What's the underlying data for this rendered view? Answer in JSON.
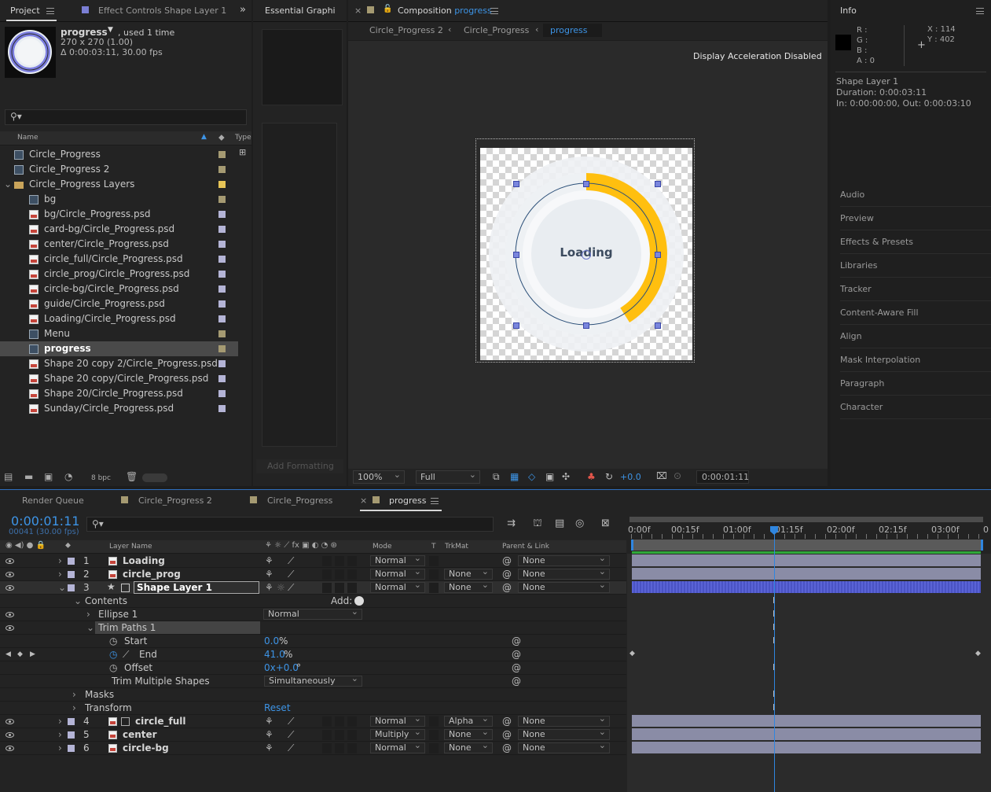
{
  "project_panel": {
    "tabs": [
      "Project",
      "Effect Controls Shape Layer 1"
    ],
    "preview_name": "progress",
    "preview_used": ", used 1 time",
    "preview_dims": "270 x 270 (1.00)",
    "preview_duration": "Δ 0:00:03:11, 30.00 fps",
    "col_name": "Name",
    "col_type": "Type",
    "bpc": "8 bpc",
    "items": [
      {
        "name": "Circle_Progress",
        "icon": "composition-icon",
        "indent": 0,
        "label": "#a59a72"
      },
      {
        "name": "Circle_Progress 2",
        "icon": "composition-icon",
        "indent": 0,
        "label": "#a59a72"
      },
      {
        "name": "Circle_Progress Layers",
        "icon": "folder-icon",
        "indent": 0,
        "label": "#e6c456",
        "expanded": true
      },
      {
        "name": "bg",
        "icon": "composition-icon",
        "indent": 1,
        "label": "#a59a72"
      },
      {
        "name": "bg/Circle_Progress.psd",
        "icon": "psd-icon",
        "indent": 1,
        "label": "#b4b4d6"
      },
      {
        "name": "card-bg/Circle_Progress.psd",
        "icon": "psd-icon",
        "indent": 1,
        "label": "#b4b4d6"
      },
      {
        "name": "center/Circle_Progress.psd",
        "icon": "psd-icon",
        "indent": 1,
        "label": "#b4b4d6"
      },
      {
        "name": "circle_full/Circle_Progress.psd",
        "icon": "psd-icon",
        "indent": 1,
        "label": "#b4b4d6"
      },
      {
        "name": "circle_prog/Circle_Progress.psd",
        "icon": "psd-icon",
        "indent": 1,
        "label": "#b4b4d6"
      },
      {
        "name": "circle-bg/Circle_Progress.psd",
        "icon": "psd-icon",
        "indent": 1,
        "label": "#b4b4d6"
      },
      {
        "name": "guide/Circle_Progress.psd",
        "icon": "psd-icon",
        "indent": 1,
        "label": "#b4b4d6"
      },
      {
        "name": "Loading/Circle_Progress.psd",
        "icon": "psd-icon",
        "indent": 1,
        "label": "#b4b4d6"
      },
      {
        "name": "Menu",
        "icon": "composition-icon",
        "indent": 1,
        "label": "#a59a72"
      },
      {
        "name": "progress",
        "icon": "composition-icon",
        "indent": 1,
        "label": "#a59a72",
        "selected": true
      },
      {
        "name": "Shape 20 copy 2/Circle_Progress.psd",
        "icon": "psd-icon",
        "indent": 1,
        "label": "#b4b4d6"
      },
      {
        "name": "Shape 20 copy/Circle_Progress.psd",
        "icon": "psd-icon",
        "indent": 1,
        "label": "#b4b4d6"
      },
      {
        "name": "Shape 20/Circle_Progress.psd",
        "icon": "psd-icon",
        "indent": 1,
        "label": "#b4b4d6"
      },
      {
        "name": "Sunday/Circle_Progress.psd",
        "icon": "psd-icon",
        "indent": 1,
        "label": "#b4b4d6"
      }
    ]
  },
  "essential_graphics": {
    "tab": "Essential Graphi",
    "add_formatting": "Add Formatting"
  },
  "composition": {
    "tab_prefix": "Composition",
    "tab_name": "progress",
    "breadcrumbs": [
      "Circle_Progress 2",
      "Circle_Progress",
      "progress"
    ],
    "notice": "Display Acceleration Disabled",
    "center_text": "Loading",
    "progress_fraction": 0.41,
    "accent_color": "#ffbf0f",
    "zoom": "100%",
    "resolution": "Full",
    "exposure": "+0.0",
    "timecode": "0:00:01:11"
  },
  "info_panel": {
    "tab": "Info",
    "r": "R :",
    "g": "G :",
    "b": "B :",
    "a": "A :  0",
    "x": "X : 114",
    "y": "Y : 402",
    "layer": "Shape Layer 1",
    "duration": "Duration: 0:00:03:11",
    "in_out": "In: 0:00:00:00, Out: 0:00:03:10"
  },
  "right_panels": [
    "Audio",
    "Preview",
    "Effects & Presets",
    "Libraries",
    "Tracker",
    "Content-Aware Fill",
    "Align",
    "Mask Interpolation",
    "Paragraph",
    "Character"
  ],
  "timeline": {
    "tabs": [
      "Render Queue",
      "Circle_Progress 2",
      "Circle_Progress",
      "progress"
    ],
    "timecode": "0:00:01:11",
    "frame_info": "00041 (30.00 fps)",
    "col_layer_name": "Layer Name",
    "col_mode": "Mode",
    "col_t": "T",
    "col_trkmat": "TrkMat",
    "col_parent": "Parent & Link",
    "ruler": [
      "0:00f",
      "00:15f",
      "01:00f",
      "01:15f",
      "02:00f",
      "02:15f",
      "03:00f",
      "0"
    ],
    "layers_top": [
      {
        "num": "1",
        "name": "Loading",
        "mode": "Normal",
        "trkmat": "",
        "parent": "None"
      },
      {
        "num": "2",
        "name": "circle_prog",
        "mode": "Normal",
        "trkmat": "None",
        "parent": "None"
      },
      {
        "num": "3",
        "name": "Shape Layer 1",
        "mode": "Normal",
        "trkmat": "None",
        "parent": "None"
      }
    ],
    "contents_label": "Contents",
    "add_label": "Add:",
    "ellipse_label": "Ellipse 1",
    "ellipse_mode": "Normal",
    "trim_label": "Trim Paths 1",
    "start_label": "Start",
    "start_value": "0.0",
    "start_unit": "%",
    "end_label": "End",
    "end_value": "41.0",
    "end_unit": "%",
    "offset_label": "Offset",
    "offset_value": "0x+0.0",
    "offset_unit": "°",
    "trim_multi_label": "Trim Multiple Shapes",
    "trim_multi_value": "Simultaneously",
    "masks_label": "Masks",
    "transform_label": "Transform",
    "reset_label": "Reset",
    "layers_bottom": [
      {
        "num": "4",
        "name": "circle_full",
        "mode": "Normal",
        "trkmat": "Alpha",
        "parent": "None"
      },
      {
        "num": "5",
        "name": "center",
        "mode": "Multiply",
        "trkmat": "None",
        "parent": "None"
      },
      {
        "num": "6",
        "name": "circle-bg",
        "mode": "Normal",
        "trkmat": "None",
        "parent": "None"
      }
    ]
  }
}
